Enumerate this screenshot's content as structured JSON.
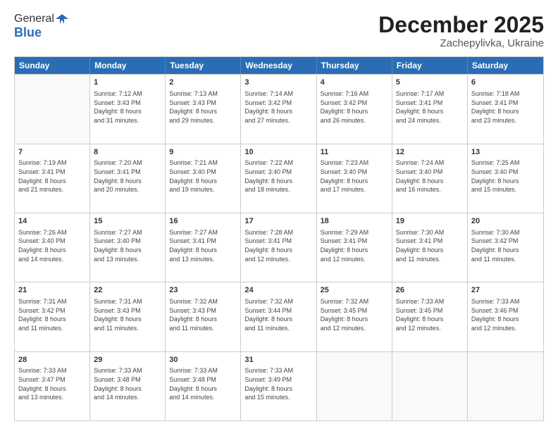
{
  "logo": {
    "line1": "General",
    "line2": "Blue"
  },
  "title": "December 2025",
  "subtitle": "Zachepylivka, Ukraine",
  "weekdays": [
    "Sunday",
    "Monday",
    "Tuesday",
    "Wednesday",
    "Thursday",
    "Friday",
    "Saturday"
  ],
  "weeks": [
    [
      {
        "day": "",
        "sunrise": "",
        "sunset": "",
        "daylight": ""
      },
      {
        "day": "1",
        "sunrise": "7:12 AM",
        "sunset": "3:43 PM",
        "daylight": "8 hours and 31 minutes."
      },
      {
        "day": "2",
        "sunrise": "7:13 AM",
        "sunset": "3:43 PM",
        "daylight": "8 hours and 29 minutes."
      },
      {
        "day": "3",
        "sunrise": "7:14 AM",
        "sunset": "3:42 PM",
        "daylight": "8 hours and 27 minutes."
      },
      {
        "day": "4",
        "sunrise": "7:16 AM",
        "sunset": "3:42 PM",
        "daylight": "8 hours and 26 minutes."
      },
      {
        "day": "5",
        "sunrise": "7:17 AM",
        "sunset": "3:41 PM",
        "daylight": "8 hours and 24 minutes."
      },
      {
        "day": "6",
        "sunrise": "7:18 AM",
        "sunset": "3:41 PM",
        "daylight": "8 hours and 23 minutes."
      }
    ],
    [
      {
        "day": "7",
        "sunrise": "7:19 AM",
        "sunset": "3:41 PM",
        "daylight": "8 hours and 21 minutes."
      },
      {
        "day": "8",
        "sunrise": "7:20 AM",
        "sunset": "3:41 PM",
        "daylight": "8 hours and 20 minutes."
      },
      {
        "day": "9",
        "sunrise": "7:21 AM",
        "sunset": "3:40 PM",
        "daylight": "8 hours and 19 minutes."
      },
      {
        "day": "10",
        "sunrise": "7:22 AM",
        "sunset": "3:40 PM",
        "daylight": "8 hours and 18 minutes."
      },
      {
        "day": "11",
        "sunrise": "7:23 AM",
        "sunset": "3:40 PM",
        "daylight": "8 hours and 17 minutes."
      },
      {
        "day": "12",
        "sunrise": "7:24 AM",
        "sunset": "3:40 PM",
        "daylight": "8 hours and 16 minutes."
      },
      {
        "day": "13",
        "sunrise": "7:25 AM",
        "sunset": "3:40 PM",
        "daylight": "8 hours and 15 minutes."
      }
    ],
    [
      {
        "day": "14",
        "sunrise": "7:26 AM",
        "sunset": "3:40 PM",
        "daylight": "8 hours and 14 minutes."
      },
      {
        "day": "15",
        "sunrise": "7:27 AM",
        "sunset": "3:40 PM",
        "daylight": "8 hours and 13 minutes."
      },
      {
        "day": "16",
        "sunrise": "7:27 AM",
        "sunset": "3:41 PM",
        "daylight": "8 hours and 13 minutes."
      },
      {
        "day": "17",
        "sunrise": "7:28 AM",
        "sunset": "3:41 PM",
        "daylight": "8 hours and 12 minutes."
      },
      {
        "day": "18",
        "sunrise": "7:29 AM",
        "sunset": "3:41 PM",
        "daylight": "8 hours and 12 minutes."
      },
      {
        "day": "19",
        "sunrise": "7:30 AM",
        "sunset": "3:41 PM",
        "daylight": "8 hours and 11 minutes."
      },
      {
        "day": "20",
        "sunrise": "7:30 AM",
        "sunset": "3:42 PM",
        "daylight": "8 hours and 11 minutes."
      }
    ],
    [
      {
        "day": "21",
        "sunrise": "7:31 AM",
        "sunset": "3:42 PM",
        "daylight": "8 hours and 11 minutes."
      },
      {
        "day": "22",
        "sunrise": "7:31 AM",
        "sunset": "3:43 PM",
        "daylight": "8 hours and 11 minutes."
      },
      {
        "day": "23",
        "sunrise": "7:32 AM",
        "sunset": "3:43 PM",
        "daylight": "8 hours and 11 minutes."
      },
      {
        "day": "24",
        "sunrise": "7:32 AM",
        "sunset": "3:44 PM",
        "daylight": "8 hours and 11 minutes."
      },
      {
        "day": "25",
        "sunrise": "7:32 AM",
        "sunset": "3:45 PM",
        "daylight": "8 hours and 12 minutes."
      },
      {
        "day": "26",
        "sunrise": "7:33 AM",
        "sunset": "3:45 PM",
        "daylight": "8 hours and 12 minutes."
      },
      {
        "day": "27",
        "sunrise": "7:33 AM",
        "sunset": "3:46 PM",
        "daylight": "8 hours and 12 minutes."
      }
    ],
    [
      {
        "day": "28",
        "sunrise": "7:33 AM",
        "sunset": "3:47 PM",
        "daylight": "8 hours and 13 minutes."
      },
      {
        "day": "29",
        "sunrise": "7:33 AM",
        "sunset": "3:48 PM",
        "daylight": "8 hours and 14 minutes."
      },
      {
        "day": "30",
        "sunrise": "7:33 AM",
        "sunset": "3:48 PM",
        "daylight": "8 hours and 14 minutes."
      },
      {
        "day": "31",
        "sunrise": "7:33 AM",
        "sunset": "3:49 PM",
        "daylight": "8 hours and 15 minutes."
      },
      {
        "day": "",
        "sunrise": "",
        "sunset": "",
        "daylight": ""
      },
      {
        "day": "",
        "sunrise": "",
        "sunset": "",
        "daylight": ""
      },
      {
        "day": "",
        "sunrise": "",
        "sunset": "",
        "daylight": ""
      }
    ]
  ]
}
